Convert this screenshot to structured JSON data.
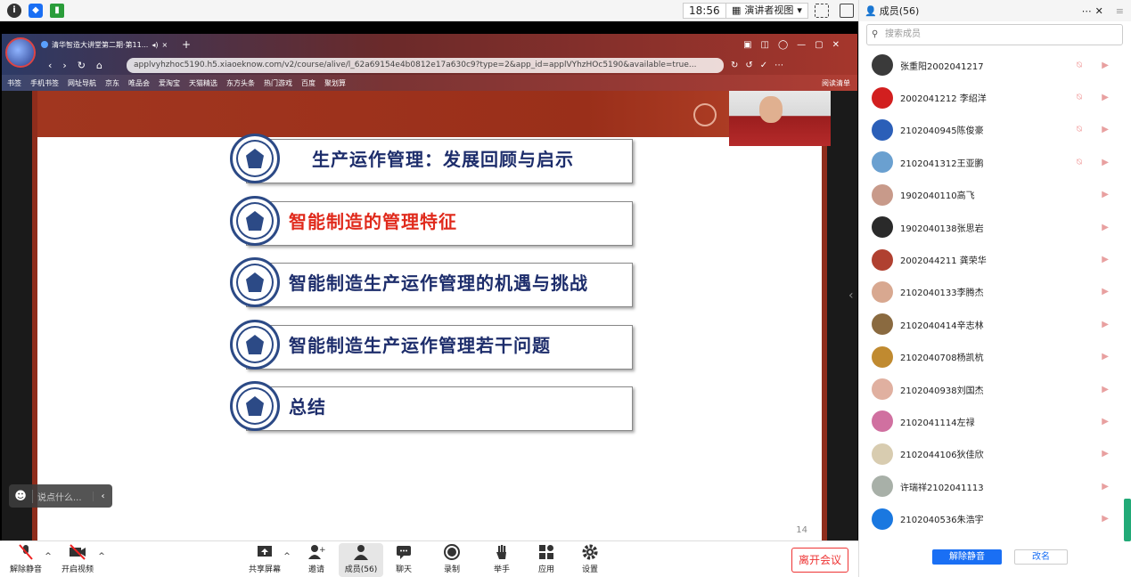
{
  "topbar": {
    "clock": "18:56",
    "view_label": "演讲者视图",
    "view_chevron": "▾"
  },
  "browser": {
    "tab_title": "清华智造大讲堂第二期·第11...",
    "url": "applvyhzhoc5190.h5.xiaoeknow.com/v2/course/alive/l_62a69154e4b0812e17a630c9?type=2&app_id=applVYhzHOc5190&available=true...",
    "bookmarks": [
      "书签",
      "手机书签",
      "网址导航",
      "京东",
      "唯品会",
      "爱淘宝",
      "天猫精选",
      "东方头条",
      "热门游戏",
      "百度",
      "聚划算",
      "阅读清单"
    ]
  },
  "slide": {
    "items": [
      {
        "text": "生产运作管理：发展回顾与启示",
        "active": false
      },
      {
        "text": "智能制造的管理特征",
        "active": true
      },
      {
        "text": "智能制造生产运作管理的机遇与挑战",
        "active": false
      },
      {
        "text": "智能制造生产运作管理若干问题",
        "active": false
      },
      {
        "text": "总结",
        "active": false
      }
    ],
    "page_number": "14",
    "accent_color": "#e02a1c",
    "text_color": "#1d2d6b"
  },
  "chat": {
    "placeholder": "说点什么..."
  },
  "toolbar": {
    "unmute": "解除静音",
    "start_video": "开启视频",
    "share_screen": "共享屏幕",
    "invite": "邀请",
    "members": "成员(56)",
    "chat": "聊天",
    "record": "录制",
    "raise_hand": "举手",
    "apps": "应用",
    "settings": "设置",
    "leave": "离开会议"
  },
  "panel": {
    "title": "成员(56)",
    "search_placeholder": "搜索成员",
    "members": [
      {
        "name": "张重阳2002041217",
        "mic_off": true,
        "color": "#3a3a3a"
      },
      {
        "name": "2002041212 李绍洋",
        "mic_off": true,
        "color": "#d21f1f"
      },
      {
        "name": "2102040945陈俊豪",
        "mic_off": true,
        "color": "#2b5fb8"
      },
      {
        "name": "2102041312王亚鹏",
        "mic_off": true,
        "color": "#6aa0d0"
      },
      {
        "name": "1902040110高飞",
        "mic_off": false,
        "color": "#c89a8a"
      },
      {
        "name": "1902040138张思岩",
        "mic_off": false,
        "color": "#2a2a2a"
      },
      {
        "name": "2002044211 龚荣华",
        "mic_off": false,
        "color": "#b04030"
      },
      {
        "name": "2102040133李腾杰",
        "mic_off": false,
        "color": "#d8a890"
      },
      {
        "name": "2102040414辛志林",
        "mic_off": false,
        "color": "#8a6a40"
      },
      {
        "name": "2102040708杨凯杭",
        "mic_off": false,
        "color": "#c08a30"
      },
      {
        "name": "2102040938刘国杰",
        "mic_off": false,
        "color": "#e0b0a0"
      },
      {
        "name": "2102041114左禄",
        "mic_off": false,
        "color": "#d070a0"
      },
      {
        "name": "2102044106狄佳欣",
        "mic_off": false,
        "color": "#d8ccb0"
      },
      {
        "name": "许瑞祥2102041113",
        "mic_off": false,
        "color": "#a8b0a8"
      },
      {
        "name": "2102040536朱浩宇",
        "mic_off": false,
        "color": "#1a78e0"
      }
    ],
    "mute_all": "解除静音",
    "rename": "改名"
  }
}
